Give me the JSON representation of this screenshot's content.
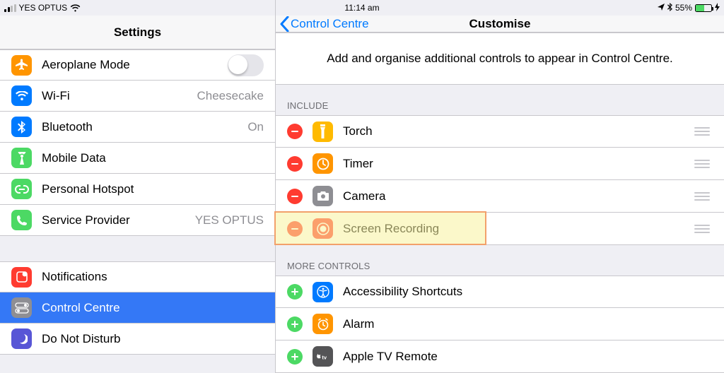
{
  "status": {
    "carrier": "YES OPTUS",
    "time": "11:14 am",
    "battery_pct": "55%",
    "battery_fill_pct": 55
  },
  "left": {
    "title": "Settings",
    "rows1": [
      {
        "label": "Aeroplane Mode",
        "trailing": "toggle",
        "icon_bg": "#ff9500"
      },
      {
        "label": "Wi-Fi",
        "trailing": "Cheesecake",
        "icon_bg": "#007aff"
      },
      {
        "label": "Bluetooth",
        "trailing": "On",
        "icon_bg": "#007aff"
      },
      {
        "label": "Mobile Data",
        "trailing": "",
        "icon_bg": "#4cd964"
      },
      {
        "label": "Personal Hotspot",
        "trailing": "",
        "icon_bg": "#4cd964"
      },
      {
        "label": "Service Provider",
        "trailing": "YES OPTUS",
        "icon_bg": "#4cd964"
      }
    ],
    "rows2": [
      {
        "label": "Notifications",
        "icon_bg": "#ff3b30"
      },
      {
        "label": "Control Centre",
        "icon_bg": "#8e8e93",
        "selected": true
      },
      {
        "label": "Do Not Disturb",
        "icon_bg": "#5856d6"
      }
    ]
  },
  "right": {
    "back_label": "Control Centre",
    "title": "Customise",
    "intro": "Add and organise additional controls to appear in Control Centre.",
    "include_header": "INCLUDE",
    "more_header": "MORE CONTROLS",
    "include": [
      {
        "label": "Torch",
        "icon_bg": "#ffba00"
      },
      {
        "label": "Timer",
        "icon_bg": "#ff9500"
      },
      {
        "label": "Camera",
        "icon_bg": "#8e8e93"
      },
      {
        "label": "Screen Recording",
        "icon_bg": "#ff3b30",
        "highlight": true
      }
    ],
    "more": [
      {
        "label": "Accessibility Shortcuts",
        "icon_bg": "#007aff"
      },
      {
        "label": "Alarm",
        "icon_bg": "#ff9500"
      },
      {
        "label": "Apple TV Remote",
        "icon_bg": "#545456"
      }
    ]
  },
  "icons": {
    "aeroplane": "airplane-icon",
    "wifi": "wifi-icon",
    "bluetooth": "bluetooth-icon",
    "mobile": "antenna-icon",
    "hotspot": "link-icon",
    "provider": "phone-icon",
    "notifications": "notifications-icon",
    "control": "toggle-icon",
    "dnd": "moon-icon",
    "torch": "torch-icon",
    "timer": "timer-icon",
    "camera": "camera-icon",
    "record": "record-icon",
    "accessibility": "accessibility-icon",
    "alarm": "alarm-icon",
    "apple_tv": "apple-tv-icon"
  }
}
